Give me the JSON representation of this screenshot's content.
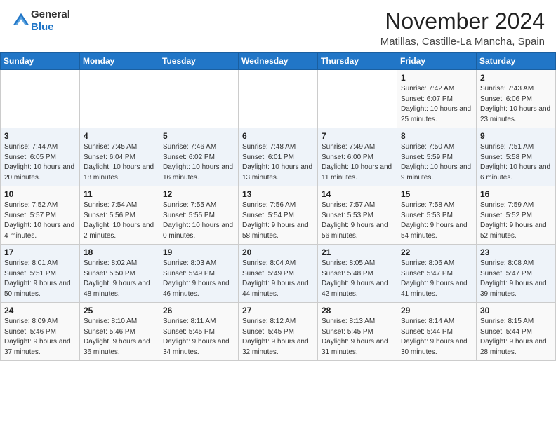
{
  "header": {
    "logo_general": "General",
    "logo_blue": "Blue",
    "month_title": "November 2024",
    "location": "Matillas, Castille-La Mancha, Spain"
  },
  "weekdays": [
    "Sunday",
    "Monday",
    "Tuesday",
    "Wednesday",
    "Thursday",
    "Friday",
    "Saturday"
  ],
  "weeks": [
    [
      {
        "day": "",
        "info": ""
      },
      {
        "day": "",
        "info": ""
      },
      {
        "day": "",
        "info": ""
      },
      {
        "day": "",
        "info": ""
      },
      {
        "day": "",
        "info": ""
      },
      {
        "day": "1",
        "info": "Sunrise: 7:42 AM\nSunset: 6:07 PM\nDaylight: 10 hours and 25 minutes."
      },
      {
        "day": "2",
        "info": "Sunrise: 7:43 AM\nSunset: 6:06 PM\nDaylight: 10 hours and 23 minutes."
      }
    ],
    [
      {
        "day": "3",
        "info": "Sunrise: 7:44 AM\nSunset: 6:05 PM\nDaylight: 10 hours and 20 minutes."
      },
      {
        "day": "4",
        "info": "Sunrise: 7:45 AM\nSunset: 6:04 PM\nDaylight: 10 hours and 18 minutes."
      },
      {
        "day": "5",
        "info": "Sunrise: 7:46 AM\nSunset: 6:02 PM\nDaylight: 10 hours and 16 minutes."
      },
      {
        "day": "6",
        "info": "Sunrise: 7:48 AM\nSunset: 6:01 PM\nDaylight: 10 hours and 13 minutes."
      },
      {
        "day": "7",
        "info": "Sunrise: 7:49 AM\nSunset: 6:00 PM\nDaylight: 10 hours and 11 minutes."
      },
      {
        "day": "8",
        "info": "Sunrise: 7:50 AM\nSunset: 5:59 PM\nDaylight: 10 hours and 9 minutes."
      },
      {
        "day": "9",
        "info": "Sunrise: 7:51 AM\nSunset: 5:58 PM\nDaylight: 10 hours and 6 minutes."
      }
    ],
    [
      {
        "day": "10",
        "info": "Sunrise: 7:52 AM\nSunset: 5:57 PM\nDaylight: 10 hours and 4 minutes."
      },
      {
        "day": "11",
        "info": "Sunrise: 7:54 AM\nSunset: 5:56 PM\nDaylight: 10 hours and 2 minutes."
      },
      {
        "day": "12",
        "info": "Sunrise: 7:55 AM\nSunset: 5:55 PM\nDaylight: 10 hours and 0 minutes."
      },
      {
        "day": "13",
        "info": "Sunrise: 7:56 AM\nSunset: 5:54 PM\nDaylight: 9 hours and 58 minutes."
      },
      {
        "day": "14",
        "info": "Sunrise: 7:57 AM\nSunset: 5:53 PM\nDaylight: 9 hours and 56 minutes."
      },
      {
        "day": "15",
        "info": "Sunrise: 7:58 AM\nSunset: 5:53 PM\nDaylight: 9 hours and 54 minutes."
      },
      {
        "day": "16",
        "info": "Sunrise: 7:59 AM\nSunset: 5:52 PM\nDaylight: 9 hours and 52 minutes."
      }
    ],
    [
      {
        "day": "17",
        "info": "Sunrise: 8:01 AM\nSunset: 5:51 PM\nDaylight: 9 hours and 50 minutes."
      },
      {
        "day": "18",
        "info": "Sunrise: 8:02 AM\nSunset: 5:50 PM\nDaylight: 9 hours and 48 minutes."
      },
      {
        "day": "19",
        "info": "Sunrise: 8:03 AM\nSunset: 5:49 PM\nDaylight: 9 hours and 46 minutes."
      },
      {
        "day": "20",
        "info": "Sunrise: 8:04 AM\nSunset: 5:49 PM\nDaylight: 9 hours and 44 minutes."
      },
      {
        "day": "21",
        "info": "Sunrise: 8:05 AM\nSunset: 5:48 PM\nDaylight: 9 hours and 42 minutes."
      },
      {
        "day": "22",
        "info": "Sunrise: 8:06 AM\nSunset: 5:47 PM\nDaylight: 9 hours and 41 minutes."
      },
      {
        "day": "23",
        "info": "Sunrise: 8:08 AM\nSunset: 5:47 PM\nDaylight: 9 hours and 39 minutes."
      }
    ],
    [
      {
        "day": "24",
        "info": "Sunrise: 8:09 AM\nSunset: 5:46 PM\nDaylight: 9 hours and 37 minutes."
      },
      {
        "day": "25",
        "info": "Sunrise: 8:10 AM\nSunset: 5:46 PM\nDaylight: 9 hours and 36 minutes."
      },
      {
        "day": "26",
        "info": "Sunrise: 8:11 AM\nSunset: 5:45 PM\nDaylight: 9 hours and 34 minutes."
      },
      {
        "day": "27",
        "info": "Sunrise: 8:12 AM\nSunset: 5:45 PM\nDaylight: 9 hours and 32 minutes."
      },
      {
        "day": "28",
        "info": "Sunrise: 8:13 AM\nSunset: 5:45 PM\nDaylight: 9 hours and 31 minutes."
      },
      {
        "day": "29",
        "info": "Sunrise: 8:14 AM\nSunset: 5:44 PM\nDaylight: 9 hours and 30 minutes."
      },
      {
        "day": "30",
        "info": "Sunrise: 8:15 AM\nSunset: 5:44 PM\nDaylight: 9 hours and 28 minutes."
      }
    ]
  ]
}
